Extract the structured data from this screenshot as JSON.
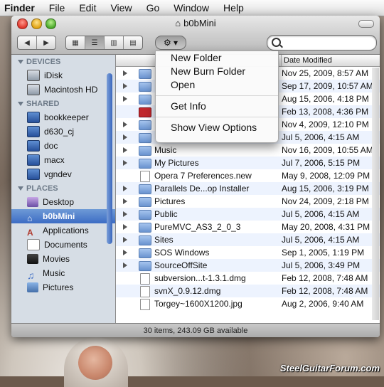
{
  "menubar": {
    "app": "Finder",
    "items": [
      "File",
      "Edit",
      "View",
      "Go",
      "Window",
      "Help"
    ]
  },
  "window": {
    "title": "b0bMini",
    "status": "30 items, 243.09 GB available",
    "search_placeholder": ""
  },
  "toolbar": {
    "back_glyph": "◀",
    "forward_glyph": "▶",
    "view_icons": "▦",
    "view_list": "☰",
    "view_columns": "▥",
    "view_coverflow": "▤",
    "action_glyph": "⚙ ▾"
  },
  "sidebar": {
    "devices_title": "DEVICES",
    "devices": [
      {
        "label": "iDisk"
      },
      {
        "label": "Macintosh HD"
      }
    ],
    "shared_title": "SHARED",
    "shared": [
      {
        "label": "bookkeeper"
      },
      {
        "label": "d630_cj"
      },
      {
        "label": "doc"
      },
      {
        "label": "macx"
      },
      {
        "label": "vgndev"
      }
    ],
    "places_title": "PLACES",
    "places": [
      {
        "label": "Desktop"
      },
      {
        "label": "b0bMini"
      },
      {
        "label": "Applications"
      },
      {
        "label": "Documents"
      },
      {
        "label": "Movies"
      },
      {
        "label": "Music"
      },
      {
        "label": "Pictures"
      }
    ]
  },
  "list": {
    "col_date": "Date Modified",
    "rows": [
      {
        "name": "",
        "date": "Nov 25, 2009, 8:57 AM"
      },
      {
        "name": "",
        "date": "Sep 17, 2009, 10:57 AM"
      },
      {
        "name": "",
        "date": "Aug 15, 2006, 4:18 PM"
      },
      {
        "name": "",
        "date": "Feb 13, 2008, 4:36 PM"
      },
      {
        "name": "",
        "date": "Nov 4, 2009, 12:10 PM"
      },
      {
        "name": "",
        "date": "Jul 5, 2006, 4:15 AM"
      },
      {
        "name": "Music",
        "date": "Nov 16, 2009, 10:55 AM"
      },
      {
        "name": "My Pictures",
        "date": "Jul 7, 2006, 5:15 PM"
      },
      {
        "name": "Opera 7 Preferences.new",
        "date": "May 9, 2008, 12:09 PM"
      },
      {
        "name": "Parallels De...op Installer",
        "date": "Aug 15, 2006, 3:19 PM"
      },
      {
        "name": "Pictures",
        "date": "Nov 24, 2009, 2:18 PM"
      },
      {
        "name": "Public",
        "date": "Jul 5, 2006, 4:15 AM"
      },
      {
        "name": "PureMVC_AS3_2_0_3",
        "date": "May 20, 2008, 4:31 PM"
      },
      {
        "name": "Sites",
        "date": "Jul 5, 2006, 4:15 AM"
      },
      {
        "name": "SOS Windows",
        "date": "Sep 1, 2005, 1:19 PM"
      },
      {
        "name": "SourceOffSite",
        "date": "Jul 5, 2006, 3:49 PM"
      },
      {
        "name": "subversion...t-1.3.1.dmg",
        "date": "Feb 12, 2008, 7:48 AM"
      },
      {
        "name": "svnX_0.9.12.dmg",
        "date": "Feb 12, 2008, 7:48 AM"
      },
      {
        "name": "Torgey~1600X1200.jpg",
        "date": "Aug 2, 2006, 9:40 AM"
      }
    ]
  },
  "action_menu": {
    "items": [
      "New Folder",
      "New Burn Folder",
      "Open",
      "Get Info",
      "Show View Options"
    ]
  },
  "watermark": "SteelGuitarForum.com"
}
